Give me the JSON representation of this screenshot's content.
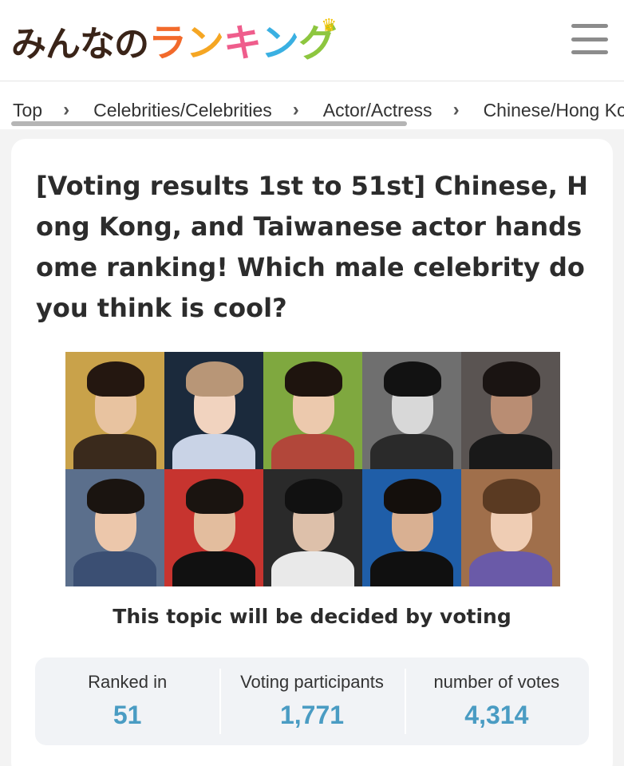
{
  "header": {
    "logo_prefix": "みんなの",
    "logo_chars": [
      {
        "ch": "ラ",
        "color": "#f26a2b"
      },
      {
        "ch": "ン",
        "color": "#f5a623"
      },
      {
        "ch": "キ",
        "color": "#ef5d8c"
      },
      {
        "ch": "ン",
        "color": "#3ab0e2"
      },
      {
        "ch": "グ",
        "color": "#8dc63f"
      }
    ],
    "crown_glyph": "♛"
  },
  "breadcrumb": {
    "items": [
      "Top",
      "Celebrities/Celebrities",
      "Actor/Actress",
      "Chinese/Hong Kong"
    ],
    "separator": "›"
  },
  "article": {
    "title": "[Voting results 1st to 51st] Chinese, Hong Kong, and Taiwanese actor handsome ranking! Which male celebrity do you think is cool?",
    "collage_tiles": [
      {
        "bg": "#c9a24a",
        "hair": "#241710",
        "face": "#e8c3a0",
        "body": "#3a2a1c"
      },
      {
        "bg": "#1b2a3c",
        "hair": "#b89677",
        "face": "#f1d3bf",
        "body": "#c9d3e6"
      },
      {
        "bg": "#7fa83f",
        "hair": "#1e140e",
        "face": "#ecc9ad",
        "body": "#b2473a"
      },
      {
        "bg": "#6f6f6f",
        "hair": "#121212",
        "face": "#d8d8d8",
        "body": "#2a2a2a"
      },
      {
        "bg": "#5a5452",
        "hair": "#1a1412",
        "face": "#b98d73",
        "body": "#191919"
      },
      {
        "bg": "#5b6f8c",
        "hair": "#1a1410",
        "face": "#ecc7ab",
        "body": "#3b4f73"
      },
      {
        "bg": "#c7342f",
        "hair": "#1a1410",
        "face": "#e3bd9e",
        "body": "#111111"
      },
      {
        "bg": "#2a2a2a",
        "hair": "#111111",
        "face": "#ddc0aa",
        "body": "#e9e9e9"
      },
      {
        "bg": "#1f5ea8",
        "hair": "#140f0c",
        "face": "#d9b092",
        "body": "#101010"
      },
      {
        "bg": "#a06f4b",
        "hair": "#5a3a22",
        "face": "#efcdb4",
        "body": "#6a5aa8"
      }
    ],
    "decided_by": "This topic will be decided by voting"
  },
  "stats": [
    {
      "label": "Ranked in",
      "value": "51"
    },
    {
      "label": "Voting participants",
      "value": "1,771"
    },
    {
      "label": "number of votes",
      "value": "4,314"
    }
  ]
}
